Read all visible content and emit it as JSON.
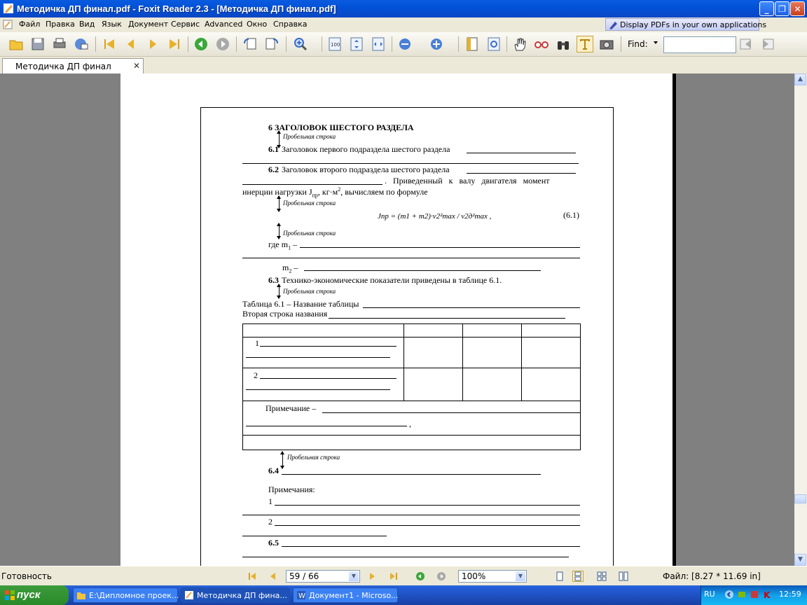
{
  "window": {
    "title": "Методичка ДП финал.pdf - Foxit Reader 2.3 - [Методичка ДП финал.pdf]",
    "minimize_label": "_",
    "restore_label": "❐",
    "close_label": "✕"
  },
  "menu": [
    "Файл",
    "Правка",
    "Вид",
    "Язык",
    "Документ",
    "Сервис",
    "Advanced",
    "Окно",
    "Справка"
  ],
  "promo": "Display PDFs in your own applications",
  "toolbar": {
    "find_label": "Find:",
    "find_value": "",
    "icons": [
      "open-icon",
      "save-icon",
      "print-icon",
      "email-icon",
      "first-page-icon",
      "prev-page-icon",
      "next-page-icon",
      "last-page-icon",
      "back-icon",
      "forward-icon",
      "rotate-left-icon",
      "rotate-right-icon",
      "zoom-in-icon",
      "actual-size-icon",
      "fit-page-icon",
      "fit-width-icon",
      "zoom-out-icon",
      "zoom-in-plus-icon",
      "bookmark-icon",
      "fit-visible-icon",
      "hand-icon",
      "glasses-icon",
      "binoculars-icon",
      "text-select-icon",
      "snapshot-icon"
    ]
  },
  "tab": {
    "label": "Методичка ДП финал",
    "close": "✕"
  },
  "document": {
    "heading": "6 ЗАГОЛОВОК ШЕСТОГО РАЗДЕЛА",
    "blank_line": "Пробельная строка",
    "s61_num": "6.1",
    "s61_text": "Заголовок первого подраздела шестого раздела",
    "s62_num": "6.2",
    "s62_text": "Заголовок второго подраздела шестого раздела",
    "s62_cont": ". Приведенный к валу двигателя момент",
    "s62_line2": "инерции нагрузки J",
    "s62_sub": "пр",
    "s62_line2b": ", кг·м",
    "s62_sup": "2",
    "s62_line2c": ", вычисляем по формуле",
    "formula": "Jпр = (m1 + m2)·v2²max / v2д²max ,",
    "formula_num": "(6.1)",
    "where": "где m",
    "where_sub": "1",
    "where_dash": " –",
    "m2": "m",
    "m2_sub": "2",
    "m2_dash": " –",
    "s63_num": "6.3",
    "s63_text": "Технико-экономические показатели приведены в таблице 6.1.",
    "table_caption": "Таблица 6.1 – Название таблицы",
    "table_caption2": "Вторая строка названия",
    "row1": "1",
    "row2": "2",
    "note": "Примечание –",
    "s64_num": "6.4",
    "notes_title": "Примечания:",
    "note1": "1",
    "note2": "2",
    "s65_num": "6.5"
  },
  "status": {
    "text": "Готовность",
    "page": "59 / 66",
    "zoom": "100%",
    "file_size": "Файл: [8.27 * 11.69 in]"
  },
  "taskbar": {
    "start": "пуск",
    "tasks": [
      "E:\\Дипломное проек...",
      "Методичка ДП фина...",
      "Документ1 - Microso..."
    ],
    "lang": "RU",
    "clock": "12:59"
  }
}
